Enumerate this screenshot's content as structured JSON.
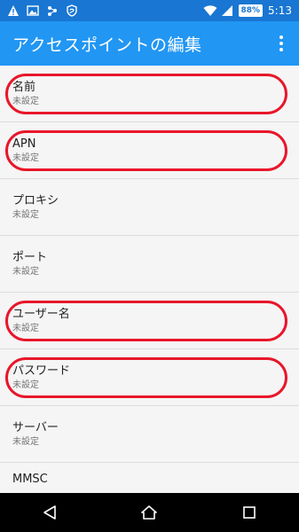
{
  "status_bar": {
    "battery": "88%",
    "time": "5:13",
    "icons": [
      "warning-icon",
      "image-icon",
      "network-icon",
      "shield-icon",
      "wifi-icon",
      "signal-icon",
      "battery-icon"
    ]
  },
  "app_bar": {
    "title": "アクセスポイントの編集",
    "menu_icon": "overflow-menu-icon"
  },
  "settings": [
    {
      "title": "名前",
      "value": "未設定",
      "highlighted": true
    },
    {
      "title": "APN",
      "value": "未設定",
      "highlighted": true
    },
    {
      "title": "プロキシ",
      "value": "未設定",
      "highlighted": false
    },
    {
      "title": "ポート",
      "value": "未設定",
      "highlighted": false
    },
    {
      "title": "ユーザー名",
      "value": "未設定",
      "highlighted": true
    },
    {
      "title": "パスワード",
      "value": "未設定",
      "highlighted": true
    },
    {
      "title": "サーバー",
      "value": "未設定",
      "highlighted": false
    },
    {
      "title": "MMSC"
    }
  ],
  "nav_bar": {
    "icons": [
      "back-icon",
      "home-icon",
      "recents-icon"
    ]
  },
  "colors": {
    "status_bar": "#1976d2",
    "app_bar": "#2196f3",
    "highlight": "#e8162a"
  }
}
